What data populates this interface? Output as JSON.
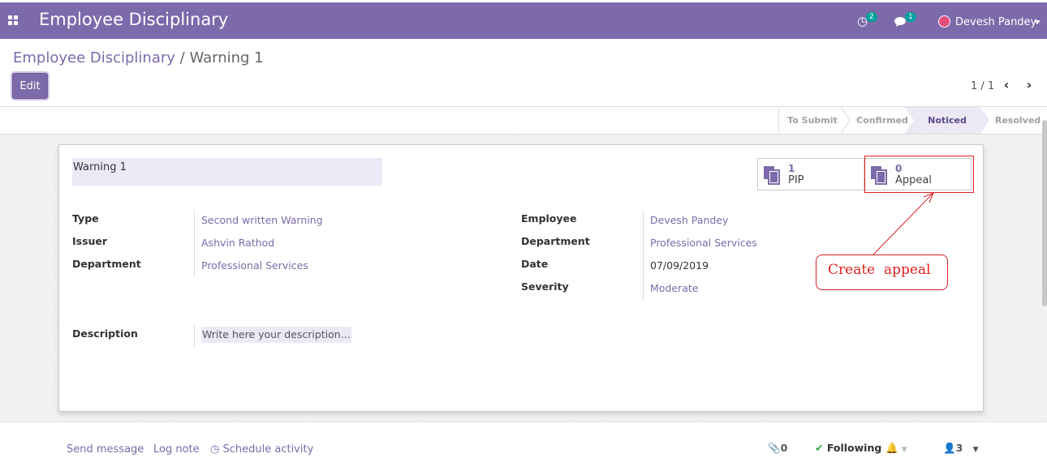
{
  "navbar": {
    "app_title": "Employee Disciplinary",
    "activity_count": "2",
    "message_count": "1",
    "user_name": "Devesh Pandey"
  },
  "breadcrumb": {
    "parent": "Employee Disciplinary",
    "separator": " / ",
    "current": "Warning 1"
  },
  "control_panel": {
    "edit_label": "Edit",
    "pager": "1 / 1"
  },
  "statusbar": {
    "stages": [
      "To Submit",
      "Confirmed",
      "Noticed",
      "Resolved"
    ],
    "active_stage": "Noticed"
  },
  "record": {
    "name": "Warning 1",
    "smart_buttons": [
      {
        "value": "1",
        "label": "PIP"
      },
      {
        "value": "0",
        "label": "Appeal"
      }
    ],
    "left_fields": [
      {
        "label": "Type",
        "value": "Second written Warning"
      },
      {
        "label": "Issuer",
        "value": "Ashvin Rathod"
      },
      {
        "label": "Department",
        "value": "Professional Services"
      }
    ],
    "right_fields": [
      {
        "label": "Employee",
        "value": "Devesh Pandey"
      },
      {
        "label": "Department",
        "value": "Professional Services"
      },
      {
        "label": "Date",
        "value": "07/09/2019"
      },
      {
        "label": "Severity",
        "value": "Moderate"
      }
    ],
    "description_label": "Description",
    "description_placeholder": "Write here your description..."
  },
  "annotation": {
    "text": "Create  appeal",
    "color": "#e02020"
  },
  "chatter": {
    "send_message": "Send message",
    "log_note": "Log note",
    "schedule_activity": "Schedule activity",
    "attachments": "0",
    "following": "Following",
    "followers": "3"
  },
  "colors": {
    "brand": "#7c6aab",
    "badge": "#00a09d"
  }
}
